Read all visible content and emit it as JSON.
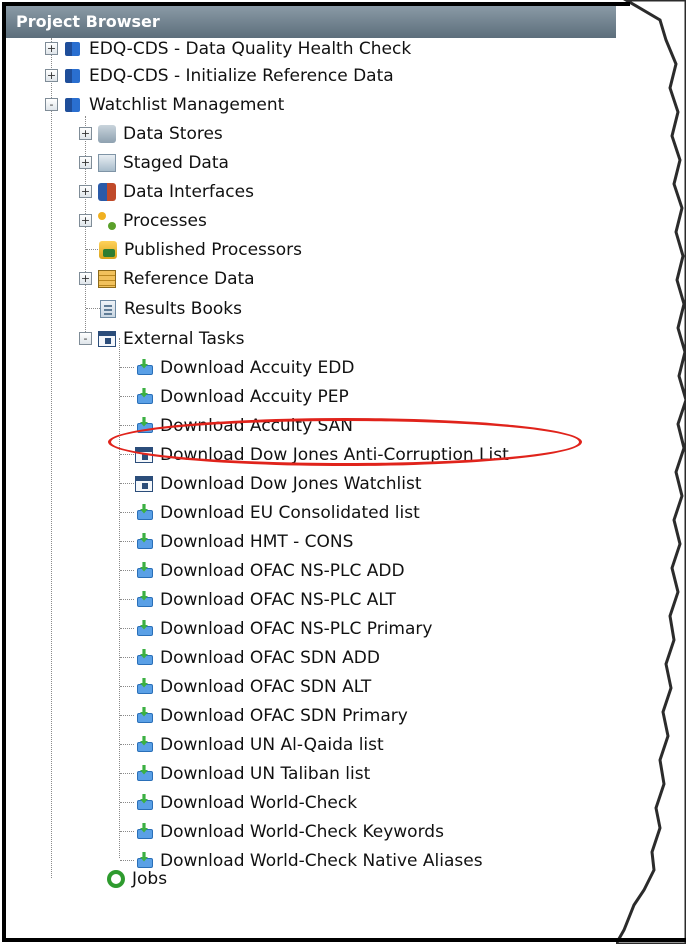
{
  "window": {
    "title": "Project Browser"
  },
  "tree": {
    "items": [
      {
        "label": "EDQ-CDS - Data Quality Health Check",
        "icon": "project-icon",
        "expander": "+"
      },
      {
        "label": "EDQ-CDS - Initialize Reference Data",
        "icon": "project-icon",
        "expander": "+"
      },
      {
        "label": "Watchlist Management",
        "icon": "project-icon",
        "expander": "-"
      },
      {
        "label": "Data Stores",
        "icon": "data-stores-icon",
        "expander": "+"
      },
      {
        "label": "Staged Data",
        "icon": "staged-data-icon",
        "expander": "+"
      },
      {
        "label": "Data Interfaces",
        "icon": "data-interfaces-icon",
        "expander": "+"
      },
      {
        "label": "Processes",
        "icon": "processes-icon",
        "expander": "+"
      },
      {
        "label": "Published Processors",
        "icon": "published-processors-icon",
        "expander": ""
      },
      {
        "label": "Reference Data",
        "icon": "reference-data-icon",
        "expander": "+"
      },
      {
        "label": "Results Books",
        "icon": "results-books-icon",
        "expander": ""
      },
      {
        "label": "External Tasks",
        "icon": "external-tasks-icon",
        "expander": "-"
      }
    ],
    "external_tasks": [
      {
        "label": "Download Accuity EDD",
        "icon": "download-task-icon"
      },
      {
        "label": "Download Accuity PEP",
        "icon": "download-task-icon"
      },
      {
        "label": "Download Accuity SAN",
        "icon": "download-task-icon"
      },
      {
        "label": "Download Dow Jones Anti-Corruption List",
        "icon": "external-task-icon",
        "highlighted": true
      },
      {
        "label": "Download Dow Jones Watchlist",
        "icon": "external-task-icon"
      },
      {
        "label": "Download EU Consolidated list",
        "icon": "download-task-icon"
      },
      {
        "label": "Download HMT - CONS",
        "icon": "download-task-icon"
      },
      {
        "label": "Download OFAC NS-PLC ADD",
        "icon": "download-task-icon"
      },
      {
        "label": "Download OFAC NS-PLC ALT",
        "icon": "download-task-icon"
      },
      {
        "label": "Download OFAC NS-PLC Primary",
        "icon": "download-task-icon"
      },
      {
        "label": "Download OFAC SDN ADD",
        "icon": "download-task-icon"
      },
      {
        "label": "Download OFAC SDN ALT",
        "icon": "download-task-icon"
      },
      {
        "label": "Download OFAC SDN Primary",
        "icon": "download-task-icon"
      },
      {
        "label": "Download UN Al-Qaida list",
        "icon": "download-task-icon"
      },
      {
        "label": "Download UN Taliban list",
        "icon": "download-task-icon"
      },
      {
        "label": "Download World-Check",
        "icon": "download-task-icon"
      },
      {
        "label": "Download World-Check Keywords",
        "icon": "download-task-icon"
      },
      {
        "label": "Download World-Check Native Aliases",
        "icon": "download-task-icon"
      }
    ],
    "jobs": {
      "label": "Jobs",
      "icon": "jobs-icon"
    }
  },
  "annotation": {
    "color": "#e0231b"
  }
}
